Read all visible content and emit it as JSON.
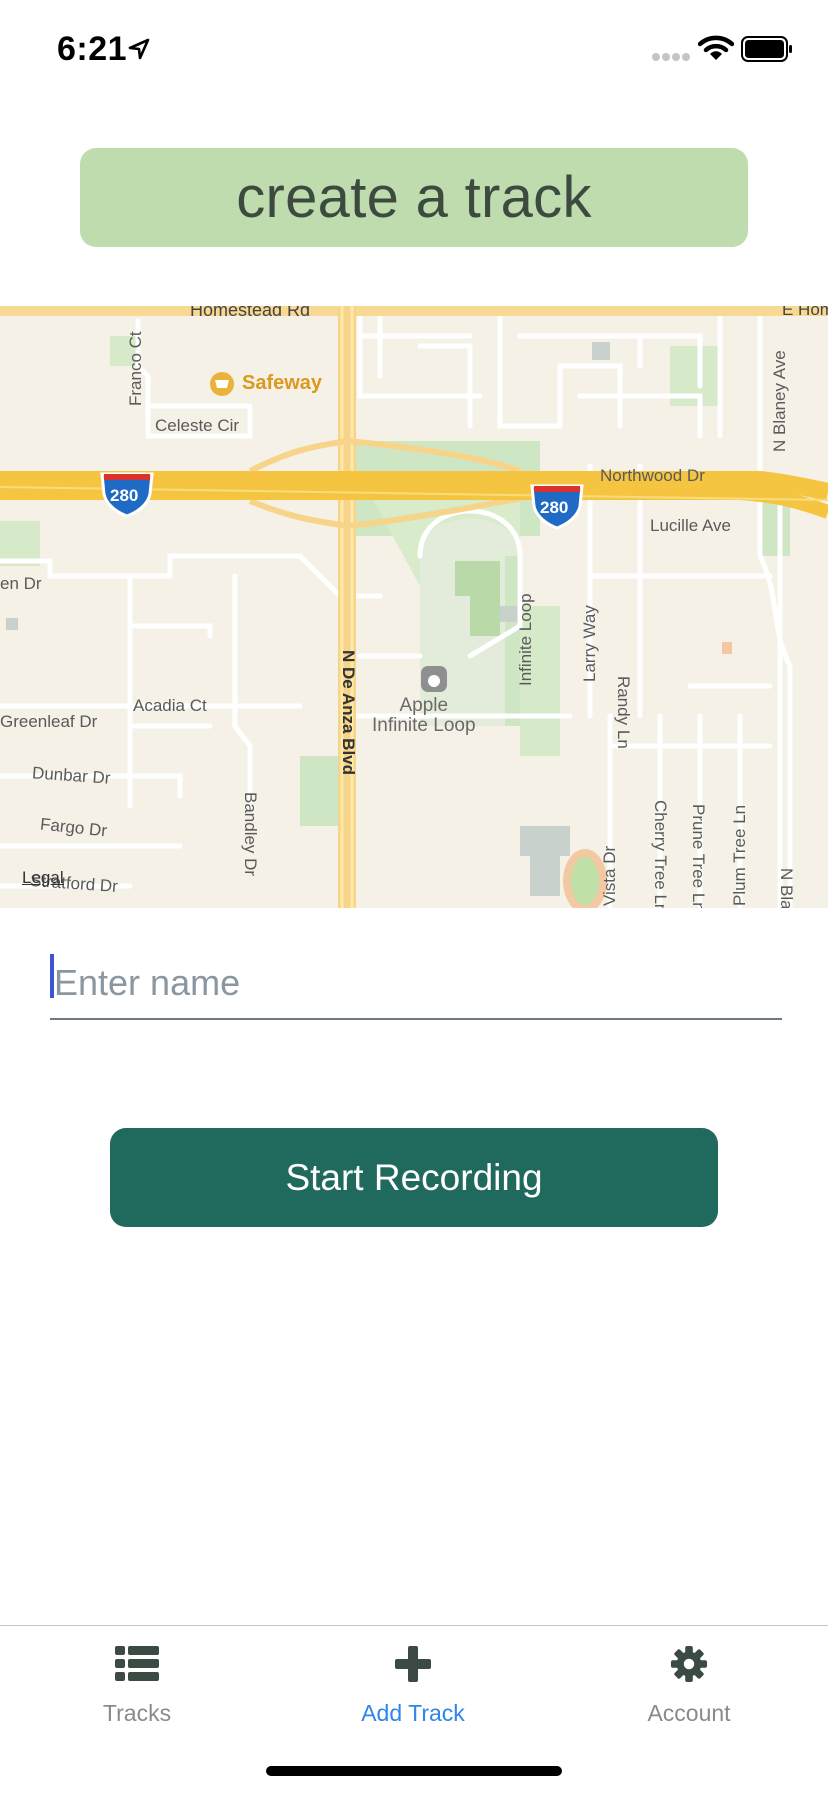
{
  "status_bar": {
    "time": "6:21"
  },
  "header": {
    "title": "create a track"
  },
  "map": {
    "pois": {
      "safeway": "Safeway",
      "apple": "Apple\nInfinite Loop"
    },
    "streets": {
      "homestead": "Homestead Rd",
      "franco": "Franco Ct",
      "celeste": "Celeste Cir",
      "northwood": "Northwood Dr",
      "lucille": "Lucille Ave",
      "n_blaney": "N Blaney Ave",
      "en_dr": "en Dr",
      "infinite_loop": "Infinite Loop",
      "larry": "Larry Way",
      "randy": "Randy Ln",
      "de_anza": "N De Anza Blvd",
      "acadia": "Acadia Ct",
      "greenleaf": "Greenleaf Dr",
      "dunbar": "Dunbar Dr",
      "fargo": "Fargo Dr",
      "bandley": "Bandley Dr",
      "stratford": "Stratford Dr",
      "vista": "Vista Dr",
      "cherry_tree": "Cherry Tree Ln",
      "prune_tree": "Prune Tree Ln",
      "plum_tree": "Plum Tree Ln",
      "n_bla": "N Bla",
      "e_hom": "E Hom"
    },
    "highway_shield": "280",
    "legal": "Legal"
  },
  "form": {
    "name_placeholder": "Enter name",
    "name_value": "",
    "start_label": "Start Recording"
  },
  "tab_bar": {
    "tabs": [
      {
        "label": "Tracks",
        "icon": "list-icon",
        "active": false
      },
      {
        "label": "Add Track",
        "icon": "plus-icon",
        "active": true
      },
      {
        "label": "Account",
        "icon": "gear-icon",
        "active": false
      }
    ]
  },
  "colors": {
    "header_bg": "#bfdcae",
    "button_bg": "#20695d",
    "active_tab": "#2f86e8",
    "inactive_tab": "#8a8a8a"
  }
}
